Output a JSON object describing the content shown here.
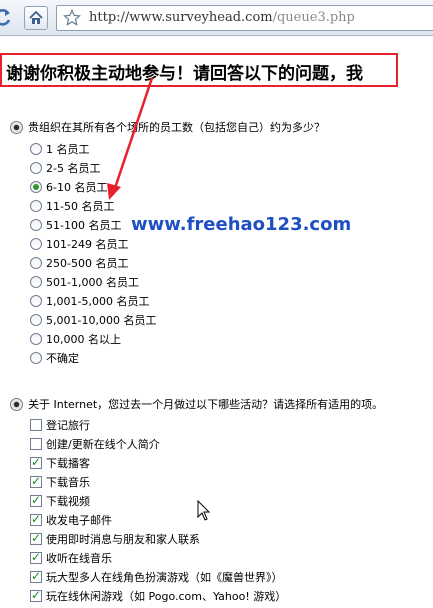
{
  "browser": {
    "url_host": "http://www.surveyhead.com",
    "url_path": "/queue3.php"
  },
  "page": {
    "heading": "谢谢你积极主动地参与！请回答以下的问题，我"
  },
  "question1": {
    "text": "贵组织在其所有各个场所的员工数（包括您自己）约为多少？",
    "selected_index": 2,
    "options": [
      "1 名员工",
      "2-5 名员工",
      "6-10 名员工",
      "11-50 名员工",
      "51-100 名员工",
      "101-249 名员工",
      "250-500 名员工",
      "501-1,000 名员工",
      "1,001-5,000 名员工",
      "5,001-10,000 名员工",
      "10,000 名以上",
      "不确定"
    ]
  },
  "question2": {
    "text": "关于 Internet，您过去一个月做过以下哪些活动？请选择所有适用的项。",
    "options": [
      {
        "label": "登记旅行",
        "checked": false
      },
      {
        "label": "创建/更新在线个人简介",
        "checked": false
      },
      {
        "label": "下载播客",
        "checked": true
      },
      {
        "label": "下载音乐",
        "checked": true
      },
      {
        "label": "下载视频",
        "checked": true
      },
      {
        "label": "收发电子邮件",
        "checked": true
      },
      {
        "label": "使用即时消息与朋友和家人联系",
        "checked": true
      },
      {
        "label": "收听在线音乐",
        "checked": true
      },
      {
        "label": "玩大型多人在线角色扮演游戏（如《魔兽世界》）",
        "checked": true
      },
      {
        "label": "玩在线休闲游戏（如 Pogo.com、Yahoo! 游戏）",
        "checked": true
      }
    ]
  },
  "watermark": "www.freehao123.com",
  "annotation_color": "#e8202e"
}
